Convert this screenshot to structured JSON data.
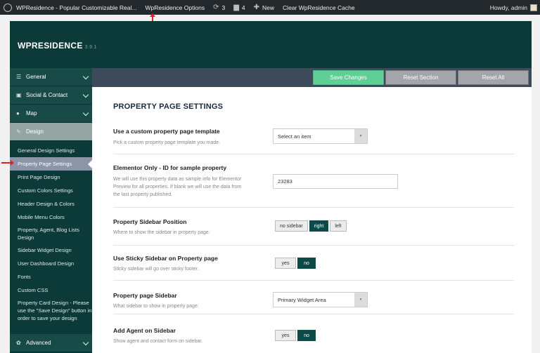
{
  "adminbar": {
    "site_name": "WPResidence - Popular Customizable Real...",
    "options_link": "WpResidence Options",
    "updates_count": "3",
    "comments_count": "4",
    "new_label": "New",
    "clear_cache": "Clear WpResidence Cache",
    "howdy": "Howdy, admin"
  },
  "header": {
    "brand": "WPRESIDENCE",
    "version": "3.9.1"
  },
  "sidebar": {
    "sections": [
      {
        "label": "General"
      },
      {
        "label": "Social & Contact"
      },
      {
        "label": "Map"
      },
      {
        "label": "Design"
      }
    ],
    "design_items": [
      "General Design Settings",
      "Property Page Settings",
      "Print Page Design",
      "Custom Colors Settings",
      "Header Design & Colors",
      "Mobile Menu Colors",
      "Property, Agent, Blog Lists Design",
      "Sidebar Widget Design",
      "User Dashboard Design",
      "Fonts",
      "Custom CSS",
      "Property Card Design - Please use the \"Save Design\" button in order to save your design"
    ],
    "advanced": "Advanced"
  },
  "toolbar": {
    "save": "Save Changes",
    "reset_section": "Reset Section",
    "reset_all": "Reset All"
  },
  "page": {
    "title": "PROPERTY PAGE SETTINGS",
    "settings": {
      "template": {
        "label": "Use a custom property page template",
        "desc": "Pick a custom property page template you made.",
        "value": "Select an item"
      },
      "elementor": {
        "label": "Elementor Only - ID for sample property",
        "desc": "We will use this property data as sample info for Elementor Preview for all properties. If blank we will use the data from the last property published.",
        "value": "23283"
      },
      "sidebar_position": {
        "label": "Property Sidebar Position",
        "desc": "Where to show the sidebar in property page.",
        "options": [
          "no sidebar",
          "right",
          "left"
        ],
        "selected": "right"
      },
      "sticky": {
        "label": "Use Sticky Sidebar on Property page",
        "desc": "Sticky sidebar will go over sticky footer.",
        "options": [
          "yes",
          "no"
        ],
        "selected": "no"
      },
      "page_sidebar": {
        "label": "Property page Sidebar",
        "desc": "What sidebar to show in property page.",
        "value": "Primary Widget Area"
      },
      "agent_sidebar": {
        "label": "Add Agent on Sidebar",
        "desc": "Show agent and contact form on sidebar.",
        "options": [
          "yes",
          "no"
        ],
        "selected": "no"
      }
    }
  }
}
